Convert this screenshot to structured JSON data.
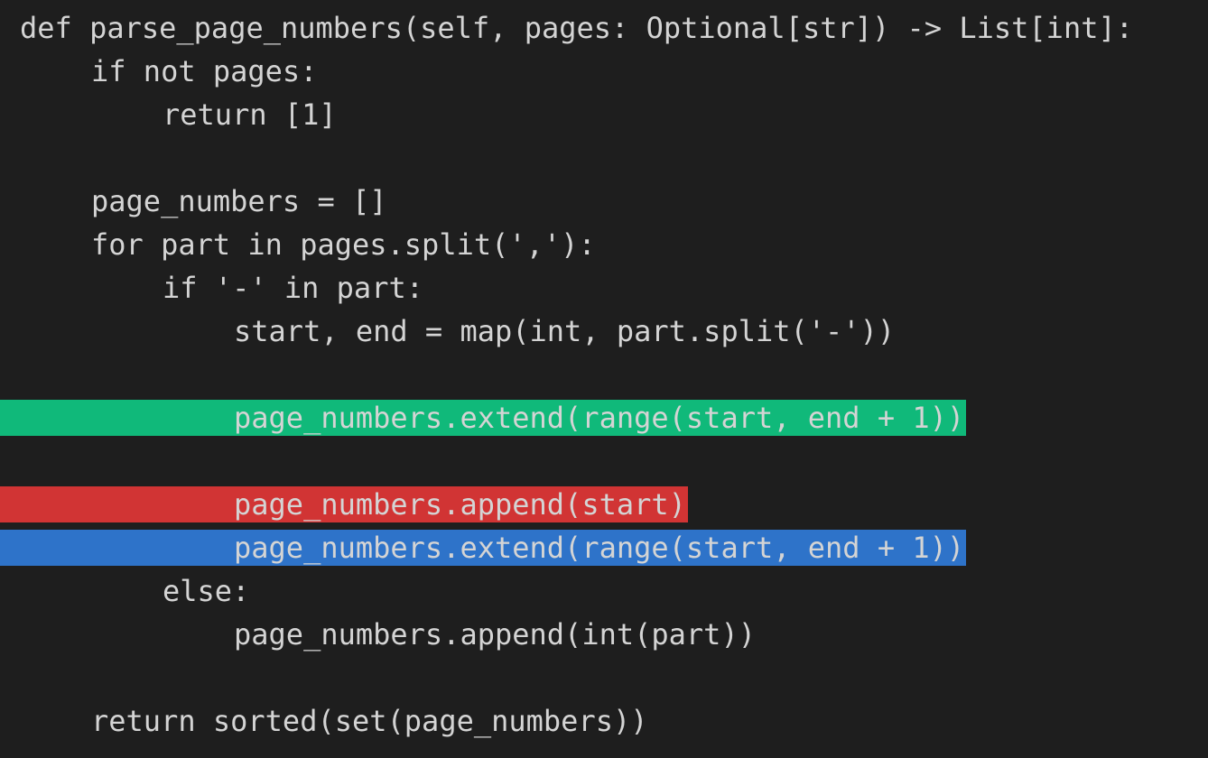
{
  "editor": {
    "lines": [
      {
        "text": "def parse_page_numbers(self, pages: Optional[str]) -> List[int]:",
        "indent": 0,
        "highlight": "none"
      },
      {
        "text": "if not pages:",
        "indent": 1,
        "highlight": "none"
      },
      {
        "text": "return [1]",
        "indent": 2,
        "highlight": "none"
      },
      {
        "text": "",
        "indent": 0,
        "highlight": "none"
      },
      {
        "text": "page_numbers = []",
        "indent": 1,
        "highlight": "none"
      },
      {
        "text": "for part in pages.split(','):",
        "indent": 1,
        "highlight": "none"
      },
      {
        "text": "if '-' in part:",
        "indent": 2,
        "highlight": "none"
      },
      {
        "text": "start, end = map(int, part.split('-'))",
        "indent": 3,
        "highlight": "none"
      },
      {
        "text": "",
        "indent": 0,
        "highlight": "none"
      },
      {
        "text": "page_numbers.extend(range(start, end + 1))",
        "indent": 3,
        "highlight": "added"
      },
      {
        "text": "",
        "indent": 0,
        "highlight": "none"
      },
      {
        "text": "page_numbers.append(start)",
        "indent": 3,
        "highlight": "removed"
      },
      {
        "text": "page_numbers.extend(range(start, end + 1))",
        "indent": 3,
        "highlight": "selected"
      },
      {
        "text": "else:",
        "indent": 2,
        "highlight": "none"
      },
      {
        "text": "page_numbers.append(int(part))",
        "indent": 3,
        "highlight": "none"
      },
      {
        "text": "",
        "indent": 0,
        "highlight": "none"
      },
      {
        "text": "return sorted(set(page_numbers))",
        "indent": 1,
        "highlight": "none"
      }
    ]
  },
  "colors": {
    "background": "#1e1e1e",
    "text": "#d4d4d4",
    "added_highlight": "#10b97a",
    "removed_highlight": "#d13434",
    "selected_highlight": "#2e73c9"
  }
}
